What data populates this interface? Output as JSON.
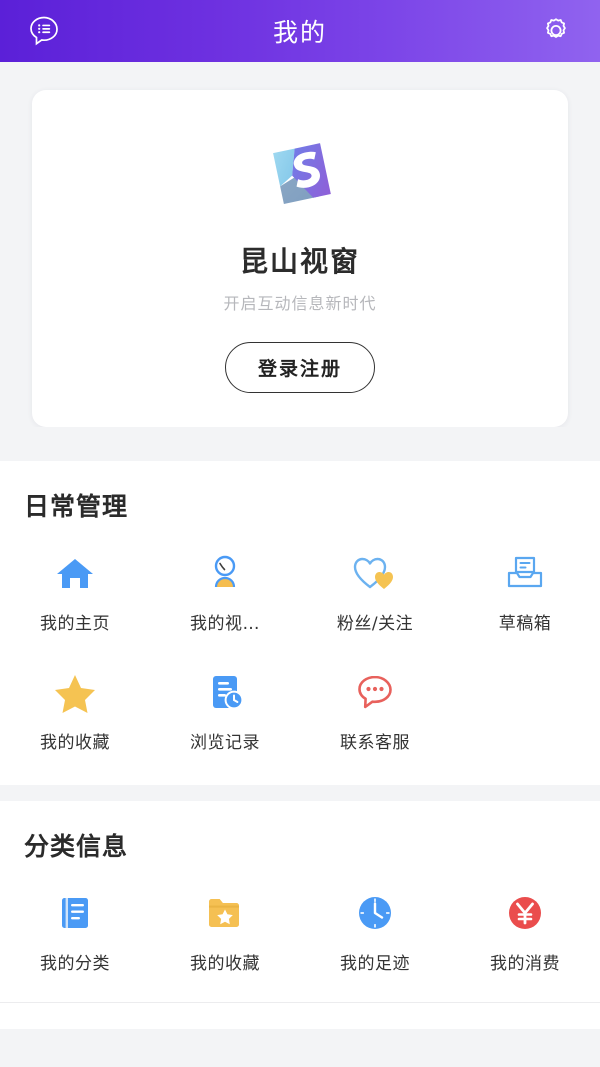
{
  "header": {
    "title": "我的",
    "left_icon": "chat-list-icon",
    "right_icon": "gear-icon",
    "gradient_start": "#5b20d8",
    "gradient_end": "#9063ef"
  },
  "profile": {
    "logo_icon": "ks-logo-icon",
    "app_name": "昆山视窗",
    "slogan": "开启互动信息新时代",
    "login_label": "登录注册"
  },
  "sections": [
    {
      "title": "日常管理",
      "dot_color": "#6b27dd",
      "items": [
        {
          "label": "我的主页",
          "icon": "home-icon",
          "color": "#4a9af5"
        },
        {
          "label": "我的视…",
          "icon": "person-icon",
          "color": "#4a9af5"
        },
        {
          "label": "粉丝/关注",
          "icon": "hearts-icon",
          "color": "#6cb2f0"
        },
        {
          "label": "草稿箱",
          "icon": "drafts-tray-icon",
          "color": "#5aa7f0"
        },
        {
          "label": "我的收藏",
          "icon": "star-icon",
          "color": "#f7c council"
        },
        {
          "label": "浏览记录",
          "icon": "history-doc-icon",
          "color": "#4a9af5"
        },
        {
          "label": "联系客服",
          "icon": "support-chat-icon",
          "color": "#e8615c"
        }
      ]
    },
    {
      "title": "分类信息",
      "dot_color": "#6b27dd",
      "items": [
        {
          "label": "我的分类",
          "icon": "document-lines-icon",
          "color": "#4a9af5"
        },
        {
          "label": "我的收藏",
          "icon": "folder-star-icon",
          "color": "#f5c156"
        },
        {
          "label": "我的足迹",
          "icon": "clock-circle-icon",
          "color": "#4a9af5"
        },
        {
          "label": "我的消费",
          "icon": "yuan-circle-icon",
          "color": "#ea4d4d"
        }
      ]
    }
  ]
}
